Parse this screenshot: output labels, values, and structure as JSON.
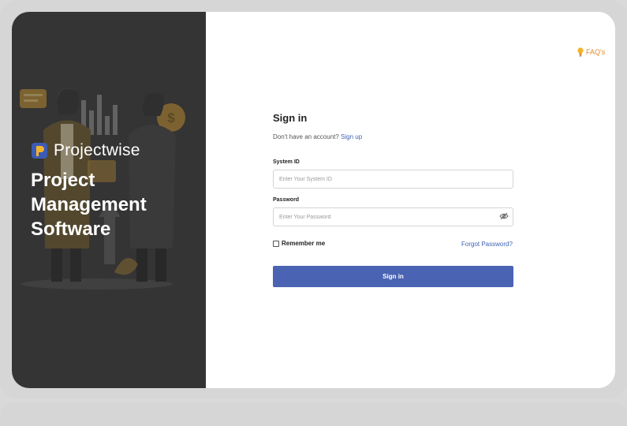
{
  "brand": {
    "name": "Projectwise",
    "tagline_lines": [
      "Project",
      "Management",
      "Software"
    ]
  },
  "header": {
    "faq_label": "FAQ's"
  },
  "form": {
    "title": "Sign in",
    "no_account_text": "Don't have an account?",
    "signup_link": "Sign up",
    "system_id_label": "System ID",
    "system_id_placeholder": "Enter Your System ID",
    "system_id_value": "",
    "password_label": "Password",
    "password_placeholder": "Enter Your Password",
    "password_value": "",
    "remember_label": "Remember me",
    "remember_checked": false,
    "forgot_link": "Forgot Password?",
    "submit_label": "Sign in"
  },
  "colors": {
    "accent": "#4a63b3",
    "link": "#3e63b2",
    "faq": "#e1892b",
    "left_panel": "#343434"
  },
  "icons": {
    "faq": "lightbulb-icon",
    "password_toggle": "eye-slash-icon",
    "brand": "projectwise-logo-icon"
  }
}
